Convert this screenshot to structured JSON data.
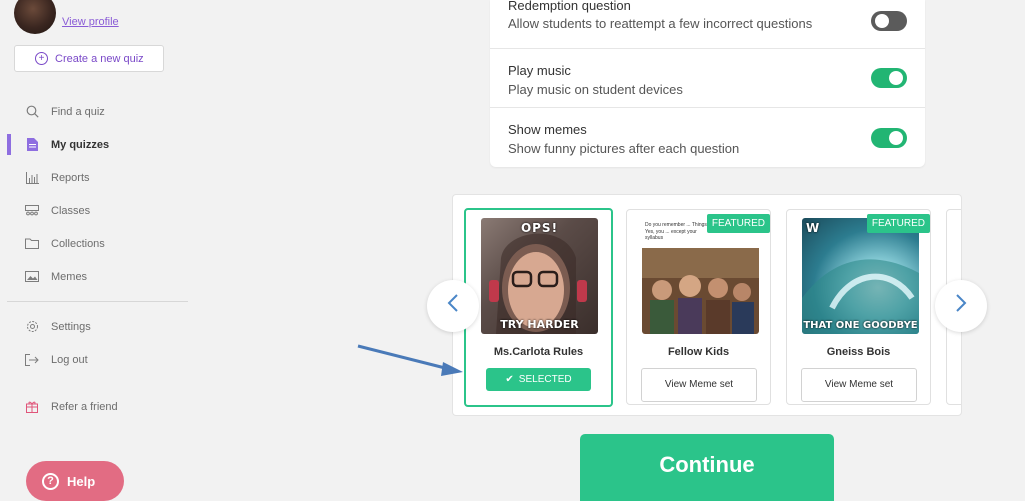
{
  "sidebar": {
    "view_profile": "View profile",
    "create_quiz": "Create a new quiz",
    "items": [
      {
        "label": "Find a quiz",
        "icon": "search-icon"
      },
      {
        "label": "My quizzes",
        "icon": "document-icon",
        "active": true
      },
      {
        "label": "Reports",
        "icon": "bar-chart-icon"
      },
      {
        "label": "Classes",
        "icon": "classes-icon"
      },
      {
        "label": "Collections",
        "icon": "folder-icon"
      },
      {
        "label": "Memes",
        "icon": "image-icon"
      }
    ],
    "bottom_items": [
      {
        "label": "Settings",
        "icon": "gear-icon"
      },
      {
        "label": "Log out",
        "icon": "logout-icon"
      }
    ],
    "refer": {
      "label": "Refer a friend",
      "icon": "gift-icon"
    },
    "help": "Help"
  },
  "settings": [
    {
      "title": "Redemption question",
      "description": "Allow students to reattempt a few incorrect questions",
      "enabled": false
    },
    {
      "title": "Play music",
      "description": "Play music on student devices",
      "enabled": true
    },
    {
      "title": "Show memes",
      "description": "Show funny pictures after each question",
      "enabled": true
    }
  ],
  "meme_sets": [
    {
      "name": "Ms.Carlota Rules",
      "selected": true,
      "button": "SELECTED",
      "top_text": "OPS!",
      "bottom_text": "TRY HARDER"
    },
    {
      "name": "Fellow Kids",
      "selected": false,
      "featured": "FEATURED",
      "button": "View Meme set",
      "caption": "Do you remember ... Things? Yes, you ... except your syllabus"
    },
    {
      "name": "Gneiss Bois",
      "selected": false,
      "featured": "FEATURED",
      "button": "View Meme set",
      "top_text": "W",
      "bottom_text": "THAT ONE GOODBYE"
    }
  ],
  "continue": "Continue",
  "colors": {
    "accent_green": "#2bc48a",
    "purple": "#8e6ee0",
    "help_pink": "#e26c83",
    "arrow_blue": "#4a86c7"
  }
}
